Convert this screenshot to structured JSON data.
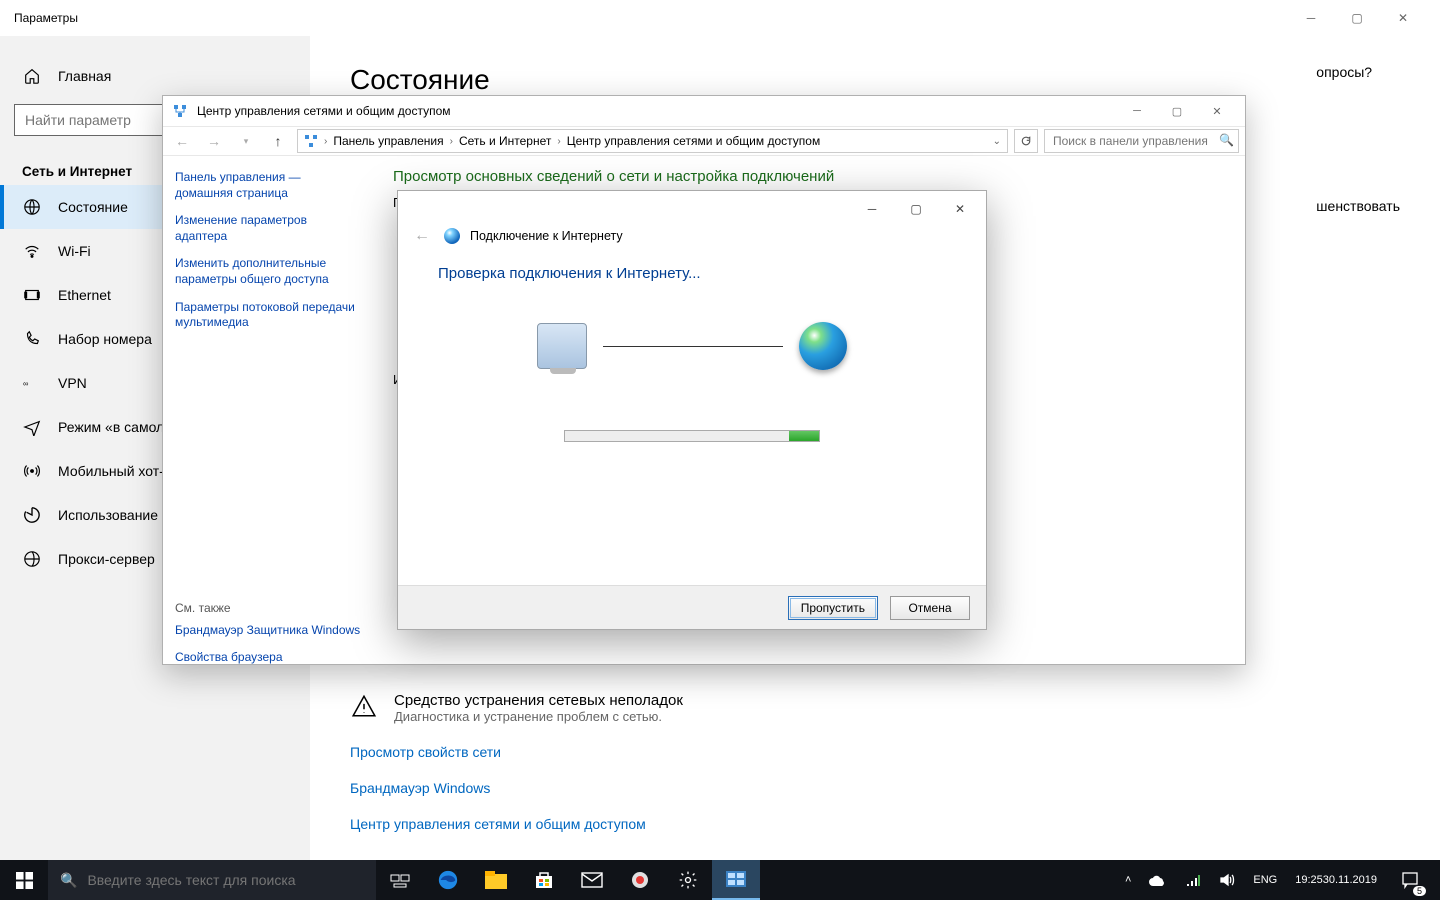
{
  "settings": {
    "window_title": "Параметры",
    "home": "Главная",
    "search_placeholder": "Найти параметр",
    "group": "Сеть и Интернет",
    "items": [
      "Состояние",
      "Wi-Fi",
      "Ethernet",
      "Набор номера",
      "VPN",
      "Режим «в самолете»",
      "Мобильный хот-спот",
      "Использование данных",
      "Прокси-сервер"
    ],
    "page_h1": "Состояние",
    "help_right_1": "опросы?",
    "help_right_2": "шенствовать",
    "troubleshoot_title": "Средство устранения сетевых неполадок",
    "troubleshoot_sub": "Диагностика и устранение проблем с сетью.",
    "links": [
      "Просмотр свойств сети",
      "Брандмауэр Windows",
      "Центр управления сетями и общим доступом"
    ]
  },
  "cp": {
    "title": "Центр управления сетями и общим доступом",
    "breadcrumb": [
      "Панель управления",
      "Сеть и Интернет",
      "Центр управления сетями и общим доступом"
    ],
    "search_placeholder": "Поиск в панели управления",
    "left": {
      "links": [
        "Панель управления — домашняя страница",
        "Изменение параметров адаптера",
        "Изменить дополнительные параметры общего доступа",
        "Параметры потоковой передачи мультимедиа"
      ],
      "see_also": "См. также",
      "see_links": [
        "Брандмауэр Защитника Windows",
        "Свойства браузера"
      ]
    },
    "main_h": "Просмотр основных сведений о сети и настройка подключений",
    "main_sub": "Про",
    "main_sub2": "Изм"
  },
  "wizard": {
    "title": "Подключение к Интернету",
    "heading": "Проверка подключения к Интернету...",
    "skip": "Пропустить",
    "cancel": "Отмена"
  },
  "taskbar": {
    "search_placeholder": "Введите здесь текст для поиска",
    "lang": "ENG",
    "time": "19:25",
    "date": "30.11.2019",
    "notif_count": "5"
  }
}
